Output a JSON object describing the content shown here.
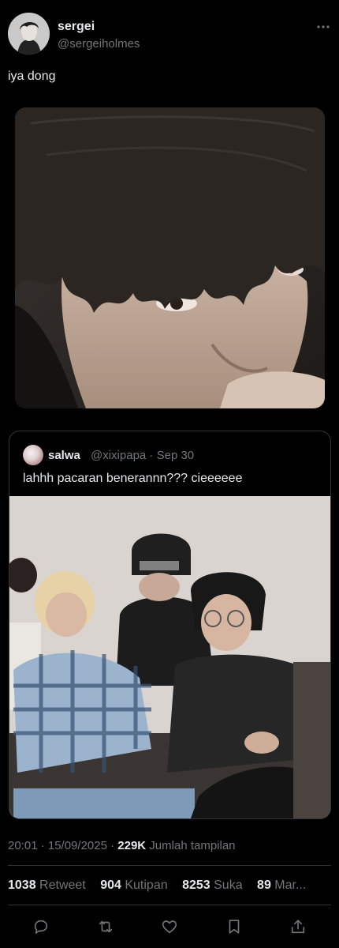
{
  "author": {
    "display_name": "sergei",
    "handle": "@sergeiholmes"
  },
  "tweet": {
    "text": "iya dong",
    "main_photo": "close-up photo of a person with dark fringe hair"
  },
  "quote": {
    "display_name": "salwa",
    "meta": "@xixipapa · Sep 30",
    "text": "lahhh pacaran benerannn??? cieeeeee",
    "photo": "group photo of four people sitting on a couch"
  },
  "meta": {
    "time": "20:01 · 15/09/2025 · ",
    "views_count": "229K",
    "views_label": " Jumlah tampilan"
  },
  "stats": {
    "retweet_count": "1038",
    "retweet_label": "Retweet",
    "quote_count": "904",
    "quote_label": "Kutipan",
    "like_count": "8253",
    "like_label": "Suka",
    "bookmark_count": "89",
    "bookmark_label": "Mar..."
  },
  "icons": {
    "more": "more-dots-icon",
    "reply": "reply-icon",
    "retweet": "retweet-icon",
    "like": "heart-icon",
    "bookmark": "bookmark-icon",
    "share": "share-icon"
  },
  "colors": {
    "background": "#000000",
    "text": "#e7e9ea",
    "secondary": "#71767b",
    "border": "#2f3336"
  }
}
